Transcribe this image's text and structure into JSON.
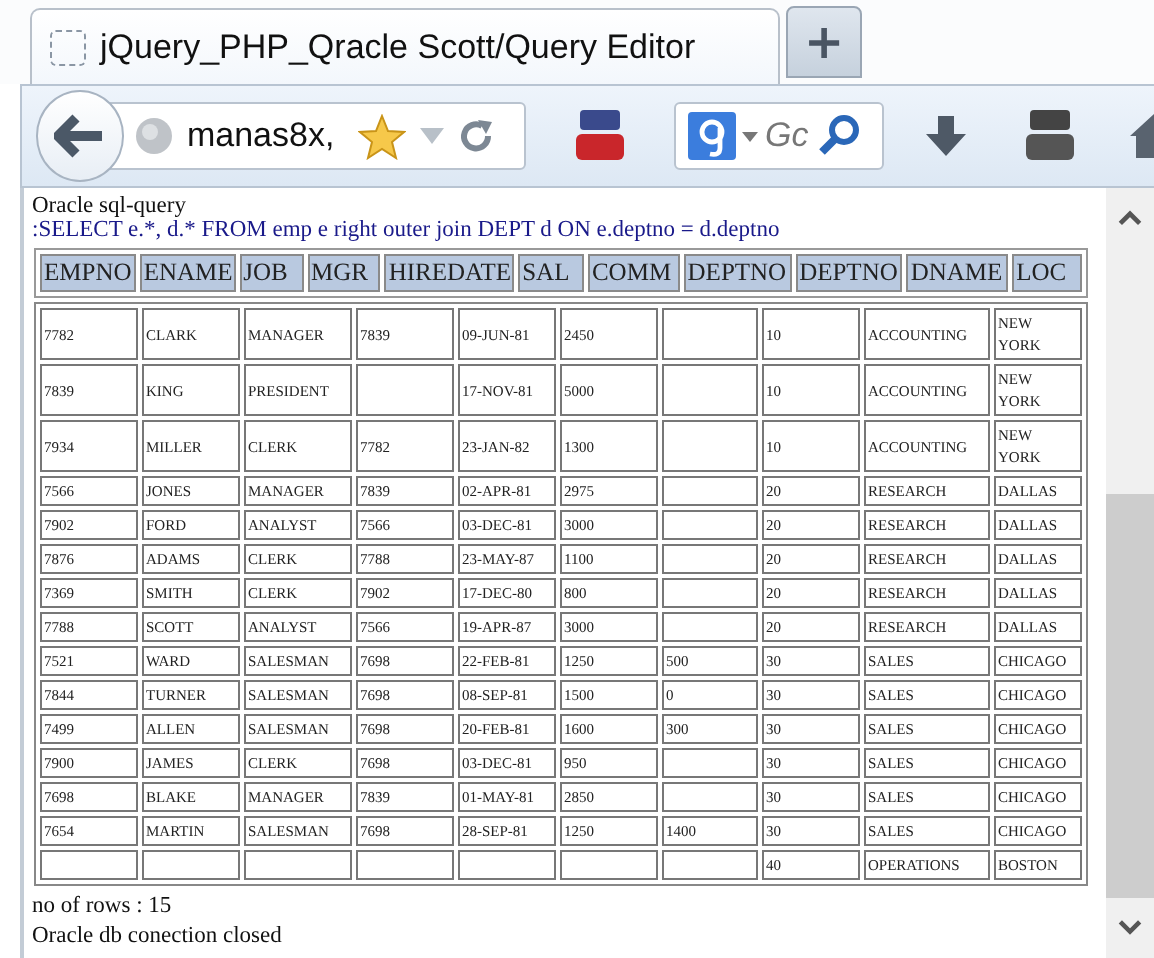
{
  "tab": {
    "title": "jQuery_PHP_Qracle Scott/Query Editor"
  },
  "new_tab_button": "+",
  "address_bar": {
    "value": "manas8x,"
  },
  "search_field": {
    "placeholder": "Gc"
  },
  "page": {
    "heading": "Oracle sql-query",
    "query": ":SELECT e.*, d.* FROM emp e right outer join DEPT d ON e.deptno = d.deptno",
    "header_bar": {
      "labels": [
        "EMPNO",
        "ENAME",
        "JOB",
        "MGR",
        "HIREDATE",
        "SAL",
        "COMM",
        "DEPTNO",
        "DEPTNO",
        "DNAME",
        "LOC"
      ]
    },
    "rows": [
      [
        "7782",
        "CLARK",
        "MANAGER",
        "7839",
        "09-JUN-81",
        "2450",
        null,
        "10",
        "ACCOUNTING",
        "NEW YORK"
      ],
      [
        "7839",
        "KING",
        "PRESIDENT",
        null,
        "17-NOV-81",
        "5000",
        null,
        "10",
        "ACCOUNTING",
        "NEW YORK"
      ],
      [
        "7934",
        "MILLER",
        "CLERK",
        "7782",
        "23-JAN-82",
        "1300",
        null,
        "10",
        "ACCOUNTING",
        "NEW YORK"
      ],
      [
        "7566",
        "JONES",
        "MANAGER",
        "7839",
        "02-APR-81",
        "2975",
        null,
        "20",
        "RESEARCH",
        "DALLAS"
      ],
      [
        "7902",
        "FORD",
        "ANALYST",
        "7566",
        "03-DEC-81",
        "3000",
        null,
        "20",
        "RESEARCH",
        "DALLAS"
      ],
      [
        "7876",
        "ADAMS",
        "CLERK",
        "7788",
        "23-MAY-87",
        "1100",
        null,
        "20",
        "RESEARCH",
        "DALLAS"
      ],
      [
        "7369",
        "SMITH",
        "CLERK",
        "7902",
        "17-DEC-80",
        "800",
        null,
        "20",
        "RESEARCH",
        "DALLAS"
      ],
      [
        "7788",
        "SCOTT",
        "ANALYST",
        "7566",
        "19-APR-87",
        "3000",
        null,
        "20",
        "RESEARCH",
        "DALLAS"
      ],
      [
        "7521",
        "WARD",
        "SALESMAN",
        "7698",
        "22-FEB-81",
        "1250",
        "500",
        "30",
        "SALES",
        "CHICAGO"
      ],
      [
        "7844",
        "TURNER",
        "SALESMAN",
        "7698",
        "08-SEP-81",
        "1500",
        "0",
        "30",
        "SALES",
        "CHICAGO"
      ],
      [
        "7499",
        "ALLEN",
        "SALESMAN",
        "7698",
        "20-FEB-81",
        "1600",
        "300",
        "30",
        "SALES",
        "CHICAGO"
      ],
      [
        "7900",
        "JAMES",
        "CLERK",
        "7698",
        "03-DEC-81",
        "950",
        null,
        "30",
        "SALES",
        "CHICAGO"
      ],
      [
        "7698",
        "BLAKE",
        "MANAGER",
        "7839",
        "01-MAY-81",
        "2850",
        null,
        "30",
        "SALES",
        "CHICAGO"
      ],
      [
        "7654",
        "MARTIN",
        "SALESMAN",
        "7698",
        "28-SEP-81",
        "1250",
        "1400",
        "30",
        "SALES",
        "CHICAGO"
      ],
      [
        null,
        null,
        null,
        null,
        null,
        null,
        null,
        "40",
        "OPERATIONS",
        "BOSTON"
      ]
    ],
    "row_count": "no of rows : 15",
    "status": "Oracle db conection closed"
  }
}
